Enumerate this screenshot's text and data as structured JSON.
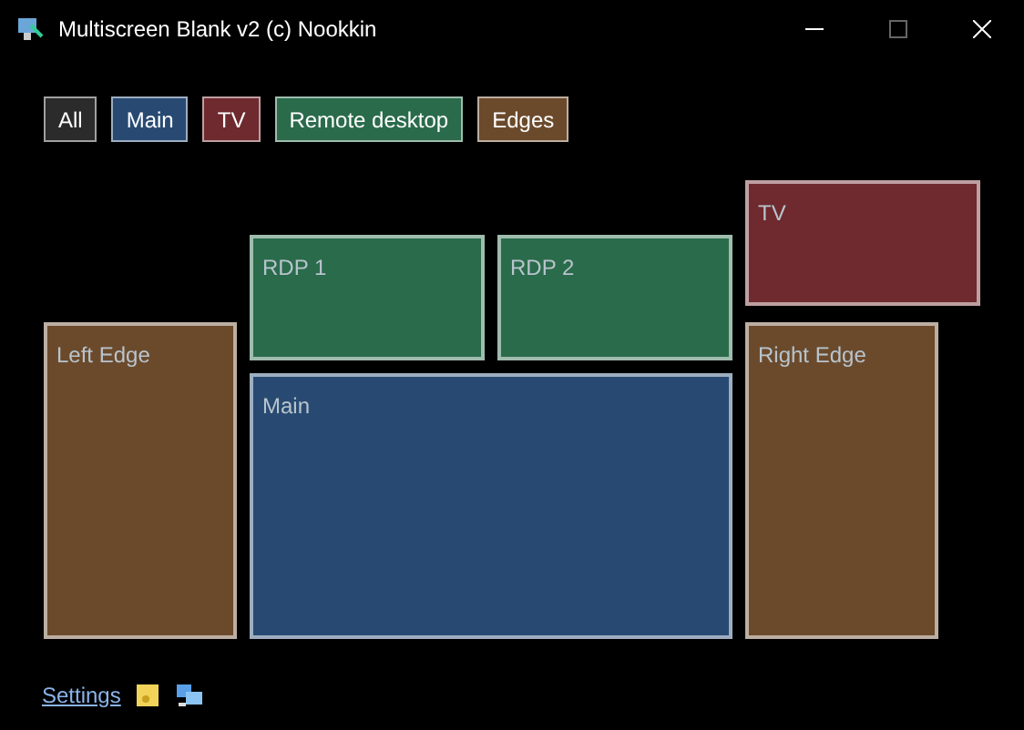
{
  "window": {
    "title": "Multiscreen Blank v2 (c) Nookkin"
  },
  "groups": [
    {
      "label": "All",
      "color": "#2b2b2b"
    },
    {
      "label": "Main",
      "color": "#284a72"
    },
    {
      "label": "TV",
      "color": "#6e2a2e"
    },
    {
      "label": "Remote desktop",
      "color": "#2a6b4b"
    },
    {
      "label": "Edges",
      "color": "#6b4a2c"
    }
  ],
  "screens": [
    {
      "label": "RDP 1",
      "color": "#2a6b4b"
    },
    {
      "label": "RDP 2",
      "color": "#2a6b4b"
    },
    {
      "label": "TV",
      "color": "#6e2a2e"
    },
    {
      "label": "Left Edge",
      "color": "#6b4a2c"
    },
    {
      "label": "Main",
      "color": "#284a72"
    },
    {
      "label": "Right Edge",
      "color": "#6b4a2c"
    }
  ],
  "footer": {
    "link": "Settings"
  }
}
